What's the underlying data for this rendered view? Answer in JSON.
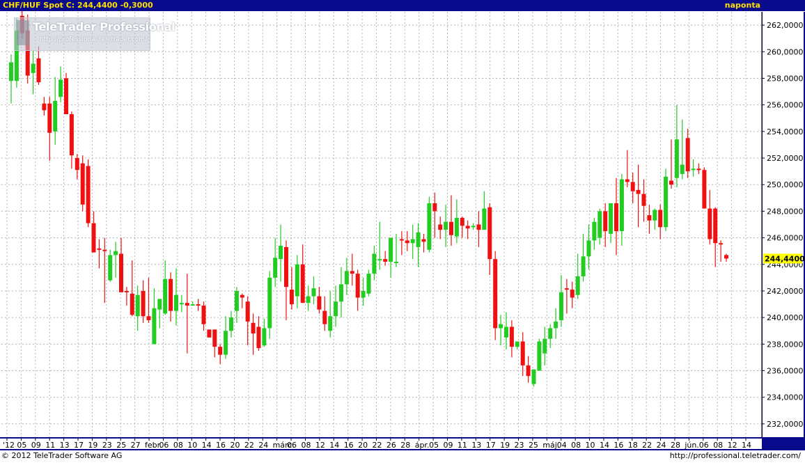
{
  "header": {
    "title": "CHF/HUF Spot C: 244,4400 -0,3000",
    "interval": "naponta"
  },
  "logo": {
    "name": "TeleTrader Professional",
    "url": "http://professional.teletrader.com/"
  },
  "footer": {
    "copyright": "© 2012 TeleTrader Software AG",
    "url": "http://professional.teletrader.com/"
  },
  "colors": {
    "up": "#22cc22",
    "down": "#ee1111",
    "header_bg": "#0a0a8c",
    "header_text": "#ffe000",
    "axis_bg": "#0a0a8c",
    "last_price_bg": "#ffff00"
  },
  "chart_data": {
    "type": "candlestick",
    "title": "CHF/HUF Spot",
    "y_axis": {
      "position": "right",
      "ylim": [
        231,
        263
      ],
      "ticks": [
        "232,0000",
        "234,0000",
        "236,0000",
        "238,0000",
        "240,0000",
        "242,0000",
        "244,0000",
        "246,0000",
        "248,0000",
        "250,0000",
        "252,0000",
        "254,0000",
        "256,0000",
        "258,0000",
        "260,0000",
        "262,0000"
      ]
    },
    "last_price": {
      "value": 244.44,
      "label": "244,4400"
    },
    "grid": true,
    "x_tick_labels": [
      "'12",
      "05",
      "09",
      "11",
      "13",
      "17",
      "19",
      "23",
      "25",
      "27",
      "febr.",
      "06",
      "08",
      "10",
      "14",
      "16",
      "20",
      "22",
      "24",
      "márc.",
      "06",
      "08",
      "12",
      "14",
      "16",
      "20",
      "22",
      "26",
      "28",
      "ápr.",
      "05",
      "09",
      "11",
      "13",
      "17",
      "19",
      "23",
      "25",
      "máj.",
      "04",
      "08",
      "10",
      "14",
      "16",
      "18",
      "22",
      "24",
      "28",
      "jún.",
      "06",
      "08",
      "12",
      "14"
    ],
    "candles": [
      {
        "o": 257.8,
        "h": 259.8,
        "l": 256.1,
        "c": 259.2
      },
      {
        "o": 257.8,
        "h": 262.5,
        "l": 257.3,
        "c": 261.6
      },
      {
        "o": 262.7,
        "h": 264.0,
        "l": 261.0,
        "c": 261.4
      },
      {
        "o": 261.6,
        "h": 262.8,
        "l": 257.6,
        "c": 258.2
      },
      {
        "o": 258.4,
        "h": 260.1,
        "l": 256.8,
        "c": 259.1
      },
      {
        "o": 259.5,
        "h": 260.4,
        "l": 257.5,
        "c": 257.7
      },
      {
        "o": 256.1,
        "h": 256.6,
        "l": 255.2,
        "c": 255.6
      },
      {
        "o": 256.1,
        "h": 256.6,
        "l": 251.8,
        "c": 253.9
      },
      {
        "o": 254.0,
        "h": 258.1,
        "l": 253.0,
        "c": 256.3
      },
      {
        "o": 256.6,
        "h": 258.9,
        "l": 256.2,
        "c": 257.9
      },
      {
        "o": 258.0,
        "h": 258.4,
        "l": 255.3,
        "c": 255.3
      },
      {
        "o": 255.3,
        "h": 255.5,
        "l": 251.2,
        "c": 252.2
      },
      {
        "o": 252.0,
        "h": 252.3,
        "l": 250.4,
        "c": 251.1
      },
      {
        "o": 251.6,
        "h": 252.2,
        "l": 248.0,
        "c": 248.5
      },
      {
        "o": 251.4,
        "h": 251.9,
        "l": 246.8,
        "c": 247.1
      },
      {
        "o": 247.1,
        "h": 248.0,
        "l": 245.0,
        "c": 244.9
      },
      {
        "o": 245.2,
        "h": 245.9,
        "l": 243.7,
        "c": 245.1
      },
      {
        "o": 245.1,
        "h": 246.0,
        "l": 241.1,
        "c": 245.0
      },
      {
        "o": 242.8,
        "h": 245.1,
        "l": 242.7,
        "c": 244.7
      },
      {
        "o": 244.7,
        "h": 245.7,
        "l": 243.0,
        "c": 245.0
      },
      {
        "o": 244.8,
        "h": 246.0,
        "l": 242.0,
        "c": 241.9
      },
      {
        "o": 242.0,
        "h": 242.3,
        "l": 240.9,
        "c": 241.9
      },
      {
        "o": 241.8,
        "h": 244.3,
        "l": 240.1,
        "c": 240.2
      },
      {
        "o": 240.1,
        "h": 242.4,
        "l": 239.0,
        "c": 241.7
      },
      {
        "o": 242.0,
        "h": 242.8,
        "l": 239.6,
        "c": 240.1
      },
      {
        "o": 240.1,
        "h": 243.0,
        "l": 239.6,
        "c": 239.8
      },
      {
        "o": 238.0,
        "h": 242.2,
        "l": 238.0,
        "c": 240.7
      },
      {
        "o": 240.6,
        "h": 241.2,
        "l": 239.2,
        "c": 241.4
      },
      {
        "o": 240.3,
        "h": 244.3,
        "l": 240.2,
        "c": 242.9
      },
      {
        "o": 242.9,
        "h": 243.4,
        "l": 239.7,
        "c": 240.5
      },
      {
        "o": 240.5,
        "h": 243.7,
        "l": 239.4,
        "c": 241.7
      },
      {
        "o": 241.1,
        "h": 241.7,
        "l": 240.4,
        "c": 241.1
      },
      {
        "o": 241.1,
        "h": 243.3,
        "l": 237.3,
        "c": 240.9
      },
      {
        "o": 241.0,
        "h": 241.2,
        "l": 241.0,
        "c": 241.0
      },
      {
        "o": 241.0,
        "h": 241.4,
        "l": 240.5,
        "c": 240.9
      },
      {
        "o": 240.9,
        "h": 241.2,
        "l": 239.0,
        "c": 239.5
      },
      {
        "o": 239.1,
        "h": 238.8,
        "l": 238.6,
        "c": 238.5
      },
      {
        "o": 239.1,
        "h": 239.1,
        "l": 237.0,
        "c": 237.8
      },
      {
        "o": 237.8,
        "h": 238.0,
        "l": 236.5,
        "c": 237.2
      },
      {
        "o": 237.2,
        "h": 240.1,
        "l": 236.9,
        "c": 239.0
      },
      {
        "o": 239.0,
        "h": 240.5,
        "l": 238.5,
        "c": 240.0
      },
      {
        "o": 240.5,
        "h": 242.3,
        "l": 239.6,
        "c": 242.0
      },
      {
        "o": 241.7,
        "h": 241.8,
        "l": 240.7,
        "c": 241.5
      },
      {
        "o": 241.2,
        "h": 241.6,
        "l": 237.9,
        "c": 239.7
      },
      {
        "o": 239.6,
        "h": 240.3,
        "l": 237.2,
        "c": 238.8
      },
      {
        "o": 239.3,
        "h": 240.1,
        "l": 237.5,
        "c": 237.7
      },
      {
        "o": 237.9,
        "h": 239.9,
        "l": 237.8,
        "c": 239.2
      },
      {
        "o": 239.2,
        "h": 243.5,
        "l": 238.4,
        "c": 243.0
      },
      {
        "o": 243.0,
        "h": 246.0,
        "l": 242.3,
        "c": 244.5
      },
      {
        "o": 244.4,
        "h": 247.0,
        "l": 242.7,
        "c": 245.4
      },
      {
        "o": 245.3,
        "h": 245.8,
        "l": 239.8,
        "c": 242.3
      },
      {
        "o": 242.1,
        "h": 243.8,
        "l": 240.6,
        "c": 241.0
      },
      {
        "o": 241.6,
        "h": 244.7,
        "l": 240.7,
        "c": 244.0
      },
      {
        "o": 244.0,
        "h": 245.5,
        "l": 242.8,
        "c": 241.1
      },
      {
        "o": 241.1,
        "h": 242.4,
        "l": 240.5,
        "c": 241.6
      },
      {
        "o": 241.6,
        "h": 243.1,
        "l": 241.0,
        "c": 242.2
      },
      {
        "o": 241.6,
        "h": 242.3,
        "l": 240.3,
        "c": 240.6
      },
      {
        "o": 240.5,
        "h": 241.6,
        "l": 239.0,
        "c": 239.5
      },
      {
        "o": 239.0,
        "h": 242.0,
        "l": 238.5,
        "c": 240.1
      },
      {
        "o": 240.1,
        "h": 242.4,
        "l": 239.3,
        "c": 241.2
      },
      {
        "o": 241.2,
        "h": 243.8,
        "l": 240.0,
        "c": 242.5
      },
      {
        "o": 242.5,
        "h": 244.5,
        "l": 241.7,
        "c": 243.5
      },
      {
        "o": 243.5,
        "h": 244.8,
        "l": 242.4,
        "c": 243.3
      },
      {
        "o": 243.3,
        "h": 243.6,
        "l": 240.5,
        "c": 241.5
      },
      {
        "o": 241.5,
        "h": 243.0,
        "l": 240.9,
        "c": 242.0
      },
      {
        "o": 241.8,
        "h": 243.6,
        "l": 241.6,
        "c": 243.3
      },
      {
        "o": 243.3,
        "h": 245.4,
        "l": 242.8,
        "c": 244.8
      },
      {
        "o": 244.4,
        "h": 247.2,
        "l": 243.6,
        "c": 244.4
      },
      {
        "o": 244.4,
        "h": 245.0,
        "l": 243.9,
        "c": 244.2
      },
      {
        "o": 244.2,
        "h": 245.2,
        "l": 243.0,
        "c": 246.0
      },
      {
        "o": 244.1,
        "h": 246.3,
        "l": 243.8,
        "c": 244.2
      },
      {
        "o": 245.9,
        "h": 246.5,
        "l": 244.7,
        "c": 245.8
      },
      {
        "o": 245.8,
        "h": 246.5,
        "l": 245.0,
        "c": 245.6
      },
      {
        "o": 245.6,
        "h": 247.0,
        "l": 244.4,
        "c": 245.9
      },
      {
        "o": 245.3,
        "h": 247.1,
        "l": 243.8,
        "c": 246.4
      },
      {
        "o": 245.9,
        "h": 246.3,
        "l": 244.9,
        "c": 245.7
      },
      {
        "o": 245.1,
        "h": 249.1,
        "l": 244.9,
        "c": 248.6
      },
      {
        "o": 248.6,
        "h": 249.4,
        "l": 246.0,
        "c": 248.0
      },
      {
        "o": 247.0,
        "h": 247.6,
        "l": 245.9,
        "c": 246.6
      },
      {
        "o": 246.6,
        "h": 248.5,
        "l": 245.3,
        "c": 247.2
      },
      {
        "o": 247.2,
        "h": 249.2,
        "l": 245.4,
        "c": 246.2
      },
      {
        "o": 246.1,
        "h": 248.9,
        "l": 245.6,
        "c": 247.5
      },
      {
        "o": 247.5,
        "h": 247.6,
        "l": 246.0,
        "c": 246.9
      },
      {
        "o": 246.9,
        "h": 247.3,
        "l": 245.9,
        "c": 246.7
      },
      {
        "o": 246.9,
        "h": 247.1,
        "l": 246.6,
        "c": 246.9
      },
      {
        "o": 247.0,
        "h": 248.0,
        "l": 245.3,
        "c": 246.6
      },
      {
        "o": 246.6,
        "h": 249.5,
        "l": 246.6,
        "c": 248.2
      },
      {
        "o": 248.3,
        "h": 248.6,
        "l": 243.2,
        "c": 244.4
      },
      {
        "o": 244.4,
        "h": 245.0,
        "l": 238.3,
        "c": 239.2
      },
      {
        "o": 239.2,
        "h": 240.2,
        "l": 237.9,
        "c": 239.5
      },
      {
        "o": 238.5,
        "h": 240.4,
        "l": 237.6,
        "c": 239.3
      },
      {
        "o": 239.3,
        "h": 239.8,
        "l": 237.0,
        "c": 237.8
      },
      {
        "o": 237.8,
        "h": 237.9,
        "l": 237.6,
        "c": 238.2
      },
      {
        "o": 238.2,
        "h": 238.9,
        "l": 235.6,
        "c": 236.4
      },
      {
        "o": 236.4,
        "h": 237.1,
        "l": 235.1,
        "c": 235.6
      },
      {
        "o": 235.0,
        "h": 236.1,
        "l": 234.8,
        "c": 236.1
      },
      {
        "o": 236.0,
        "h": 238.4,
        "l": 236.0,
        "c": 238.2
      },
      {
        "o": 237.3,
        "h": 239.3,
        "l": 236.4,
        "c": 238.4
      },
      {
        "o": 238.4,
        "h": 239.5,
        "l": 237.7,
        "c": 239.2
      },
      {
        "o": 239.2,
        "h": 240.7,
        "l": 238.4,
        "c": 239.7
      },
      {
        "o": 239.8,
        "h": 243.2,
        "l": 239.3,
        "c": 241.9
      },
      {
        "o": 242.2,
        "h": 242.9,
        "l": 240.3,
        "c": 242.1
      },
      {
        "o": 242.1,
        "h": 242.7,
        "l": 240.7,
        "c": 241.5
      },
      {
        "o": 241.7,
        "h": 244.8,
        "l": 241.4,
        "c": 243.1
      },
      {
        "o": 243.1,
        "h": 246.3,
        "l": 242.7,
        "c": 244.6
      },
      {
        "o": 244.6,
        "h": 247.0,
        "l": 243.6,
        "c": 245.8
      },
      {
        "o": 245.8,
        "h": 247.5,
        "l": 245.1,
        "c": 247.2
      },
      {
        "o": 246.0,
        "h": 248.2,
        "l": 245.5,
        "c": 248.0
      },
      {
        "o": 248.0,
        "h": 248.6,
        "l": 245.3,
        "c": 246.5
      },
      {
        "o": 246.3,
        "h": 248.3,
        "l": 245.6,
        "c": 248.6
      },
      {
        "o": 248.6,
        "h": 250.5,
        "l": 244.7,
        "c": 246.5
      },
      {
        "o": 246.5,
        "h": 250.8,
        "l": 245.4,
        "c": 250.4
      },
      {
        "o": 250.4,
        "h": 252.6,
        "l": 249.8,
        "c": 250.2
      },
      {
        "o": 250.2,
        "h": 250.9,
        "l": 248.6,
        "c": 249.5
      },
      {
        "o": 249.6,
        "h": 251.5,
        "l": 246.8,
        "c": 249.3
      },
      {
        "o": 249.3,
        "h": 250.4,
        "l": 247.2,
        "c": 248.4
      },
      {
        "o": 247.7,
        "h": 248.5,
        "l": 246.3,
        "c": 247.3
      },
      {
        "o": 247.3,
        "h": 248.2,
        "l": 246.6,
        "c": 248.1
      },
      {
        "o": 248.1,
        "h": 248.5,
        "l": 245.9,
        "c": 246.8
      },
      {
        "o": 246.8,
        "h": 251.2,
        "l": 246.5,
        "c": 250.6
      },
      {
        "o": 250.3,
        "h": 253.4,
        "l": 249.7,
        "c": 250.0
      },
      {
        "o": 250.5,
        "h": 256.0,
        "l": 249.8,
        "c": 253.4
      },
      {
        "o": 250.8,
        "h": 254.9,
        "l": 250.4,
        "c": 251.5
      },
      {
        "o": 253.5,
        "h": 254.2,
        "l": 250.5,
        "c": 251.0
      },
      {
        "o": 251.2,
        "h": 251.9,
        "l": 250.6,
        "c": 251.2
      },
      {
        "o": 251.2,
        "h": 251.6,
        "l": 250.8,
        "c": 251.1
      },
      {
        "o": 251.1,
        "h": 251.3,
        "l": 248.5,
        "c": 248.2
      },
      {
        "o": 248.2,
        "h": 249.6,
        "l": 245.5,
        "c": 245.9
      },
      {
        "o": 248.2,
        "h": 248.3,
        "l": 243.8,
        "c": 245.6
      },
      {
        "o": 245.6,
        "h": 245.8,
        "l": 244.2,
        "c": 245.5
      },
      {
        "o": 244.7,
        "h": 244.8,
        "l": 244.2,
        "c": 244.44
      }
    ]
  }
}
